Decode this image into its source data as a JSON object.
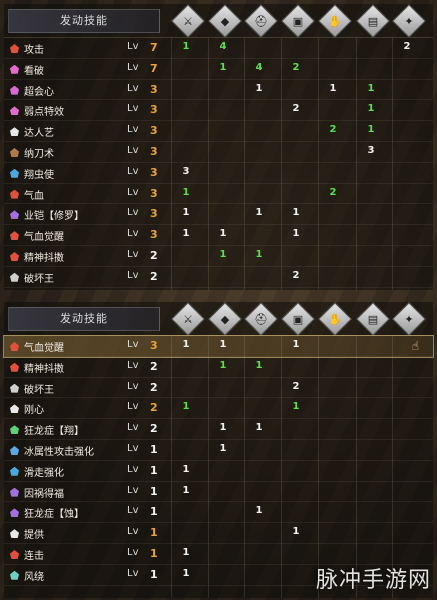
{
  "colors": {
    "green": "#5fdc4f",
    "white": "#f2f2f2",
    "orange": "#e8a23a",
    "highlight": "#8c6e3c"
  },
  "columns": [
    {
      "icon": "sword-icon",
      "glyph": "⚔"
    },
    {
      "icon": "gem-icon",
      "glyph": "◆"
    },
    {
      "icon": "helmet-icon",
      "glyph": "⛑"
    },
    {
      "icon": "chestplate-icon",
      "glyph": "▣"
    },
    {
      "icon": "gauntlet-icon",
      "glyph": "✋"
    },
    {
      "icon": "waist-icon",
      "glyph": "▤"
    },
    {
      "icon": "charm-icon",
      "glyph": "✦"
    }
  ],
  "table1": {
    "header": "发动技能",
    "rows": [
      {
        "name": "攻击",
        "lv_label": "Lv",
        "level": "7",
        "level_color": "#e8a23a",
        "icon_color": "#e0503c",
        "cells": [
          "1",
          "4",
          "",
          "",
          "",
          "",
          "2"
        ],
        "cell_colors": [
          "#5fdc4f",
          "#5fdc4f",
          "",
          "",
          "",
          "",
          "#f2f2f2"
        ]
      },
      {
        "name": "看破",
        "lv_label": "Lv",
        "level": "7",
        "level_color": "#e8a23a",
        "icon_color": "#e36bd0",
        "cells": [
          "",
          "1",
          "4",
          "2",
          "",
          "",
          ""
        ],
        "cell_colors": [
          "",
          "#5fdc4f",
          "#5fdc4f",
          "#5fdc4f",
          "",
          "",
          ""
        ]
      },
      {
        "name": "超会心",
        "lv_label": "Lv",
        "level": "3",
        "level_color": "#e8a23a",
        "icon_color": "#d96ad4",
        "cells": [
          "",
          "",
          "1",
          "",
          "1",
          "1",
          ""
        ],
        "cell_colors": [
          "",
          "",
          "#f2f2f2",
          "",
          "#f2f2f2",
          "#5fdc4f",
          ""
        ]
      },
      {
        "name": "弱点特效",
        "lv_label": "Lv",
        "level": "3",
        "level_color": "#e8a23a",
        "icon_color": "#e36bd0",
        "cells": [
          "",
          "",
          "",
          "2",
          "",
          "1",
          ""
        ],
        "cell_colors": [
          "",
          "",
          "",
          "#f2f2f2",
          "",
          "#5fdc4f",
          ""
        ]
      },
      {
        "name": "达人艺",
        "lv_label": "Lv",
        "level": "3",
        "level_color": "#e8a23a",
        "icon_color": "#e8e8e8",
        "cells": [
          "",
          "",
          "",
          "",
          "2",
          "1",
          ""
        ],
        "cell_colors": [
          "",
          "",
          "",
          "",
          "#5fdc4f",
          "#5fdc4f",
          ""
        ]
      },
      {
        "name": "纳刀术",
        "lv_label": "Lv",
        "level": "3",
        "level_color": "#e8a23a",
        "icon_color": "#b07a4a",
        "cells": [
          "",
          "",
          "",
          "",
          "",
          "3",
          ""
        ],
        "cell_colors": [
          "",
          "",
          "",
          "",
          "",
          "#f2f2f2",
          ""
        ]
      },
      {
        "name": "翔虫使",
        "lv_label": "Lv",
        "level": "3",
        "level_color": "#e8a23a",
        "icon_color": "#4aa8e0",
        "cells": [
          "3",
          "",
          "",
          "",
          "",
          "",
          ""
        ],
        "cell_colors": [
          "#f2f2f2",
          "",
          "",
          "",
          "",
          "",
          ""
        ]
      },
      {
        "name": "气血",
        "lv_label": "Lv",
        "level": "3",
        "level_color": "#e8a23a",
        "icon_color": "#e0503c",
        "cells": [
          "1",
          "",
          "",
          "",
          "2",
          "",
          ""
        ],
        "cell_colors": [
          "#5fdc4f",
          "",
          "",
          "",
          "#5fdc4f",
          "",
          ""
        ]
      },
      {
        "name": "业铠【修罗】",
        "lv_label": "Lv",
        "level": "3",
        "level_color": "#e8a23a",
        "icon_color": "#a070e0",
        "cells": [
          "1",
          "",
          "1",
          "1",
          "",
          "",
          ""
        ],
        "cell_colors": [
          "#f2f2f2",
          "",
          "#f2f2f2",
          "#f2f2f2",
          "",
          "",
          ""
        ]
      },
      {
        "name": "气血觉醒",
        "lv_label": "Lv",
        "level": "3",
        "level_color": "#e8a23a",
        "icon_color": "#e0503c",
        "cells": [
          "1",
          "1",
          "",
          "1",
          "",
          "",
          ""
        ],
        "cell_colors": [
          "#f2f2f2",
          "#f2f2f2",
          "",
          "#f2f2f2",
          "",
          "",
          ""
        ]
      },
      {
        "name": "精神抖擞",
        "lv_label": "Lv",
        "level": "2",
        "level_color": "#f2f2f2",
        "icon_color": "#e0503c",
        "cells": [
          "",
          "1",
          "1",
          "",
          "",
          "",
          ""
        ],
        "cell_colors": [
          "",
          "#5fdc4f",
          "#5fdc4f",
          "",
          "",
          "",
          ""
        ]
      },
      {
        "name": "破坏王",
        "lv_label": "Lv",
        "level": "2",
        "level_color": "#f2f2f2",
        "icon_color": "#cfcfcf",
        "cells": [
          "",
          "",
          "",
          "2",
          "",
          "",
          ""
        ],
        "cell_colors": [
          "",
          "",
          "",
          "#f2f2f2",
          "",
          "",
          ""
        ]
      }
    ]
  },
  "table2": {
    "header": "发动技能",
    "rows": [
      {
        "name": "气血觉醒",
        "lv_label": "Lv",
        "level": "3",
        "level_color": "#e8a23a",
        "icon_color": "#e0503c",
        "cells": [
          "1",
          "1",
          "",
          "1",
          "",
          "",
          ""
        ],
        "cell_colors": [
          "#f2f2f2",
          "#f2f2f2",
          "",
          "#f2f2f2",
          "",
          "",
          ""
        ],
        "highlight": true
      },
      {
        "name": "精神抖擞",
        "lv_label": "Lv",
        "level": "2",
        "level_color": "#f2f2f2",
        "icon_color": "#e0503c",
        "cells": [
          "",
          "1",
          "1",
          "",
          "",
          "",
          ""
        ],
        "cell_colors": [
          "",
          "#5fdc4f",
          "#5fdc4f",
          "",
          "",
          "",
          ""
        ]
      },
      {
        "name": "破坏王",
        "lv_label": "Lv",
        "level": "2",
        "level_color": "#f2f2f2",
        "icon_color": "#cfcfcf",
        "cells": [
          "",
          "",
          "",
          "2",
          "",
          "",
          ""
        ],
        "cell_colors": [
          "",
          "",
          "",
          "#f2f2f2",
          "",
          "",
          ""
        ]
      },
      {
        "name": "刚心",
        "lv_label": "Lv",
        "level": "2",
        "level_color": "#e8a23a",
        "icon_color": "#e8e8e8",
        "cells": [
          "1",
          "",
          "",
          "1",
          "",
          "",
          ""
        ],
        "cell_colors": [
          "#5fdc4f",
          "",
          "",
          "#5fdc4f",
          "",
          "",
          ""
        ]
      },
      {
        "name": "狂龙症【翔】",
        "lv_label": "Lv",
        "level": "2",
        "level_color": "#f2f2f2",
        "icon_color": "#5fcf7a",
        "cells": [
          "",
          "1",
          "1",
          "",
          "",
          "",
          ""
        ],
        "cell_colors": [
          "",
          "#f2f2f2",
          "#f2f2f2",
          "",
          "",
          "",
          ""
        ]
      },
      {
        "name": "冰属性攻击强化",
        "lv_label": "Lv",
        "level": "1",
        "level_color": "#f2f2f2",
        "icon_color": "#5aa8e6",
        "cells": [
          "",
          "1",
          "",
          "",
          "",
          "",
          ""
        ],
        "cell_colors": [
          "",
          "#f2f2f2",
          "",
          "",
          "",
          "",
          ""
        ]
      },
      {
        "name": "滑走强化",
        "lv_label": "Lv",
        "level": "1",
        "level_color": "#f2f2f2",
        "icon_color": "#4aa8e0",
        "cells": [
          "1",
          "",
          "",
          "",
          "",
          "",
          ""
        ],
        "cell_colors": [
          "#f2f2f2",
          "",
          "",
          "",
          "",
          "",
          ""
        ]
      },
      {
        "name": "因祸得福",
        "lv_label": "Lv",
        "level": "1",
        "level_color": "#f2f2f2",
        "icon_color": "#a070e0",
        "cells": [
          "1",
          "",
          "",
          "",
          "",
          "",
          ""
        ],
        "cell_colors": [
          "#f2f2f2",
          "",
          "",
          "",
          "",
          "",
          ""
        ]
      },
      {
        "name": "狂龙症【蚀】",
        "lv_label": "Lv",
        "level": "1",
        "level_color": "#f2f2f2",
        "icon_color": "#a070e0",
        "cells": [
          "",
          "",
          "1",
          "",
          "",
          "",
          ""
        ],
        "cell_colors": [
          "",
          "",
          "#f2f2f2",
          "",
          "",
          "",
          ""
        ]
      },
      {
        "name": "提供",
        "lv_label": "Lv",
        "level": "1",
        "level_color": "#e8a23a",
        "icon_color": "#e8e8e8",
        "cells": [
          "",
          "",
          "",
          "1",
          "",
          "",
          ""
        ],
        "cell_colors": [
          "",
          "",
          "",
          "#f2f2f2",
          "",
          "",
          ""
        ]
      },
      {
        "name": "连击",
        "lv_label": "Lv",
        "level": "1",
        "level_color": "#e8a23a",
        "icon_color": "#e0503c",
        "cells": [
          "1",
          "",
          "",
          "",
          "",
          "",
          ""
        ],
        "cell_colors": [
          "#f2f2f2",
          "",
          "",
          "",
          "",
          "",
          ""
        ]
      },
      {
        "name": "风绕",
        "lv_label": "Lv",
        "level": "1",
        "level_color": "#f2f2f2",
        "icon_color": "#6ad0c0",
        "cells": [
          "1",
          "",
          "",
          "",
          "",
          "",
          ""
        ],
        "cell_colors": [
          "#f2f2f2",
          "",
          "",
          "",
          "",
          "",
          ""
        ]
      }
    ]
  },
  "row1_cells": [
    "",
    "",
    "",
    "",
    "",
    "",
    "",
    "",
    "",
    ""
  ],
  "watermark": "脉冲手游网"
}
